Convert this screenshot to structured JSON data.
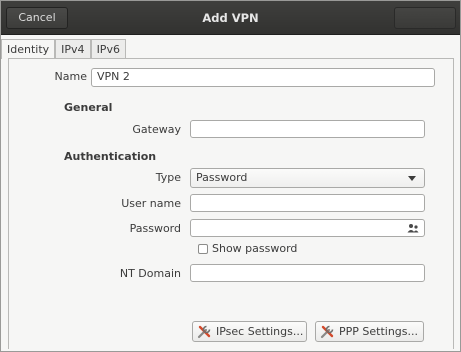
{
  "header": {
    "cancel_label": "Cancel",
    "title": "Add VPN"
  },
  "tabs": [
    {
      "label": "Identity",
      "active": true
    },
    {
      "label": "IPv4",
      "active": false
    },
    {
      "label": "IPv6",
      "active": false
    }
  ],
  "form": {
    "name": {
      "label": "Name",
      "value": "VPN 2"
    },
    "general": {
      "heading": "General",
      "gateway": {
        "label": "Gateway",
        "value": ""
      }
    },
    "authentication": {
      "heading": "Authentication",
      "type": {
        "label": "Type",
        "value": "Password"
      },
      "username": {
        "label": "User name",
        "value": ""
      },
      "password": {
        "label": "Password",
        "value": ""
      },
      "show_password": {
        "label": "Show password",
        "checked": false
      },
      "nt_domain": {
        "label": "NT Domain",
        "value": ""
      }
    }
  },
  "buttons": {
    "ipsec_label": "IPsec Settings...",
    "ppp_label": "PPP Settings..."
  },
  "icons": {
    "password_field_icon": "users-icon",
    "settings_button_icon": "tools-icon"
  },
  "colors": {
    "titlebar": "#3a3a38",
    "tool_icon_red": "#d24a2c"
  }
}
